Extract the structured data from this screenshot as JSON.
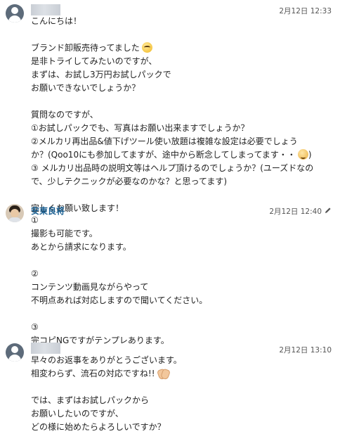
{
  "messages": [
    {
      "sender_name": "",
      "time": "2月12日 12:33",
      "avatar": "default-user-avatar",
      "lines": [
        "こんにちは！",
        "",
        "ブランド卸販売待ってました",
        "是非トライしてみたいのですが、",
        "まずは、お試し3万円お試しパックで",
        "お願いできないでしょうか？",
        "",
        "質問なのですが、",
        "①お試しパックでも、写真はお願い出来ますでしょうか？",
        "②メルカリ再出品&値下げツール使い放題は複雑な設定は必要でしょう",
        "か？(Qoo10にも参加してますが、途中から断念してしまってます・・",
        "③ メルカリ出品時の説明文等はヘルプ頂けるのでしょうか？(ユーズドなの",
        "で、少しテクニックが必要なのかな？と思ってます)",
        "",
        "宜しくお願い致します！"
      ],
      "line10_suffix": ")",
      "emoji_line3": "thinking-face-emoji",
      "emoji_line11": "sad-face-emoji"
    },
    {
      "sender_name": "安東良将",
      "time": "2月12日 12:40",
      "avatar": "user-photo-avatar",
      "edit_icon": "pencil-icon",
      "lines": [
        "①",
        "撮影も可能です。",
        "あとから請求になります。",
        "",
        "②",
        "コンテンツ動画見ながらやって",
        "不明点あれば対応しますので聞いてください。",
        "",
        "③",
        "完コピNGですがテンプレあります。"
      ]
    },
    {
      "sender_name": "",
      "time": "2月12日 13:10",
      "avatar": "default-user-avatar",
      "lines": [
        "早々のお返事をありがとうございます。",
        "相変わらず、流石の対応ですね!!",
        "",
        "では、まずはお試しパックから",
        "お願いしたいのですが、",
        "どの様に始めたらよろしいですか？"
      ],
      "emoji_line2": "clapping-hands-emoji"
    }
  ],
  "colors": {
    "name": "#1a5f91",
    "text": "#222222",
    "time": "#555555"
  }
}
